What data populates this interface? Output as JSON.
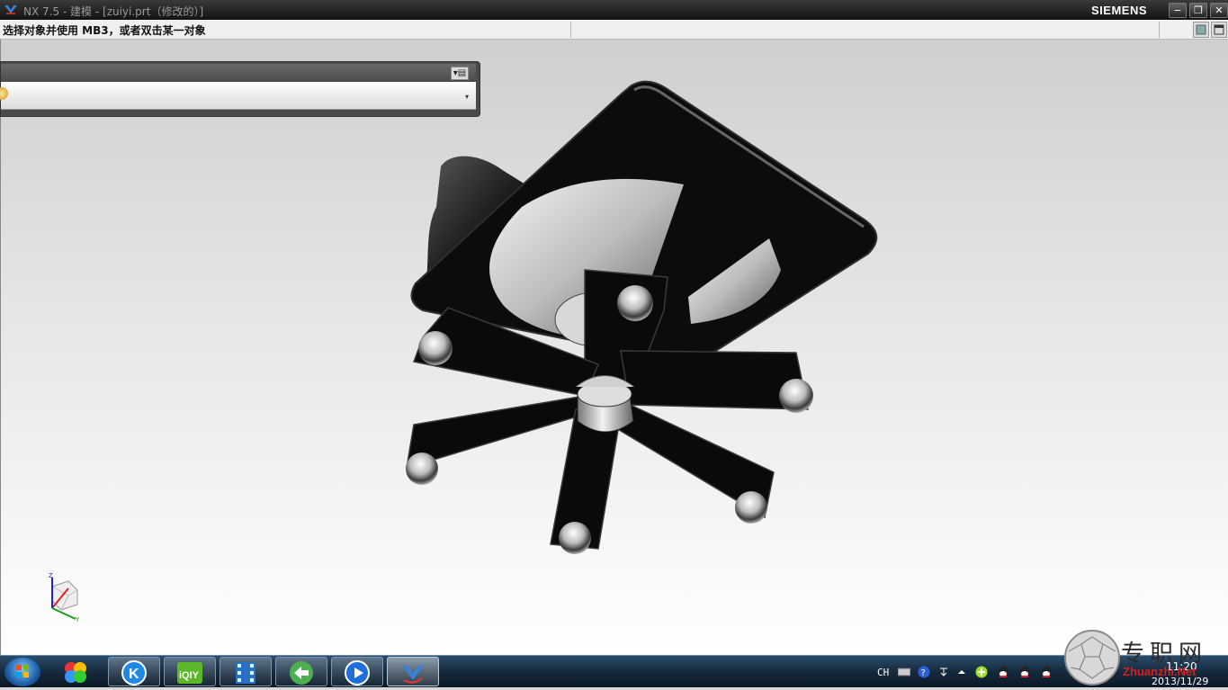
{
  "window": {
    "title": "NX 7.5 - 建模 - [zuiyi.prt（修改的）]",
    "brand": "SIEMENS",
    "controls": {
      "minimize": "−",
      "restore": "❐",
      "close": "✕"
    }
  },
  "cue_line": {
    "prompt": "选择对象并使用 MB3，或者双击某一对象"
  },
  "selection_bar": {
    "menu_glyph": "▾▤",
    "dropdown_arrow": "▾"
  },
  "viewport": {
    "triad_axes": {
      "z": "Z",
      "y": "Y"
    }
  },
  "taskbar": {
    "apps": [
      {
        "name": "start-button"
      },
      {
        "name": "picasa",
        "icon": "pinwheel-icon"
      },
      {
        "name": "kugou",
        "icon": "k-icon"
      },
      {
        "name": "iqiyi",
        "icon": "iqiyi-icon",
        "label": "iQIY"
      },
      {
        "name": "film-app",
        "icon": "film-icon"
      },
      {
        "name": "browser",
        "icon": "globe-icon"
      },
      {
        "name": "media-player",
        "icon": "play-icon"
      },
      {
        "name": "nx",
        "icon": "nx-icon"
      }
    ],
    "language": "CH",
    "clock": {
      "time": "11:20",
      "date": "2013/11/29"
    }
  },
  "watermark": {
    "text": "专职网",
    "sub": "Zhuanzhi.Net"
  },
  "colors": {
    "titlebar": "#1a1a1a",
    "viewport_top": "#cfcfcf",
    "viewport_bottom": "#ffffff",
    "model_dark": "#0d0d0d",
    "taskbar": "#162a3e",
    "watermark_red": "#d42020"
  }
}
